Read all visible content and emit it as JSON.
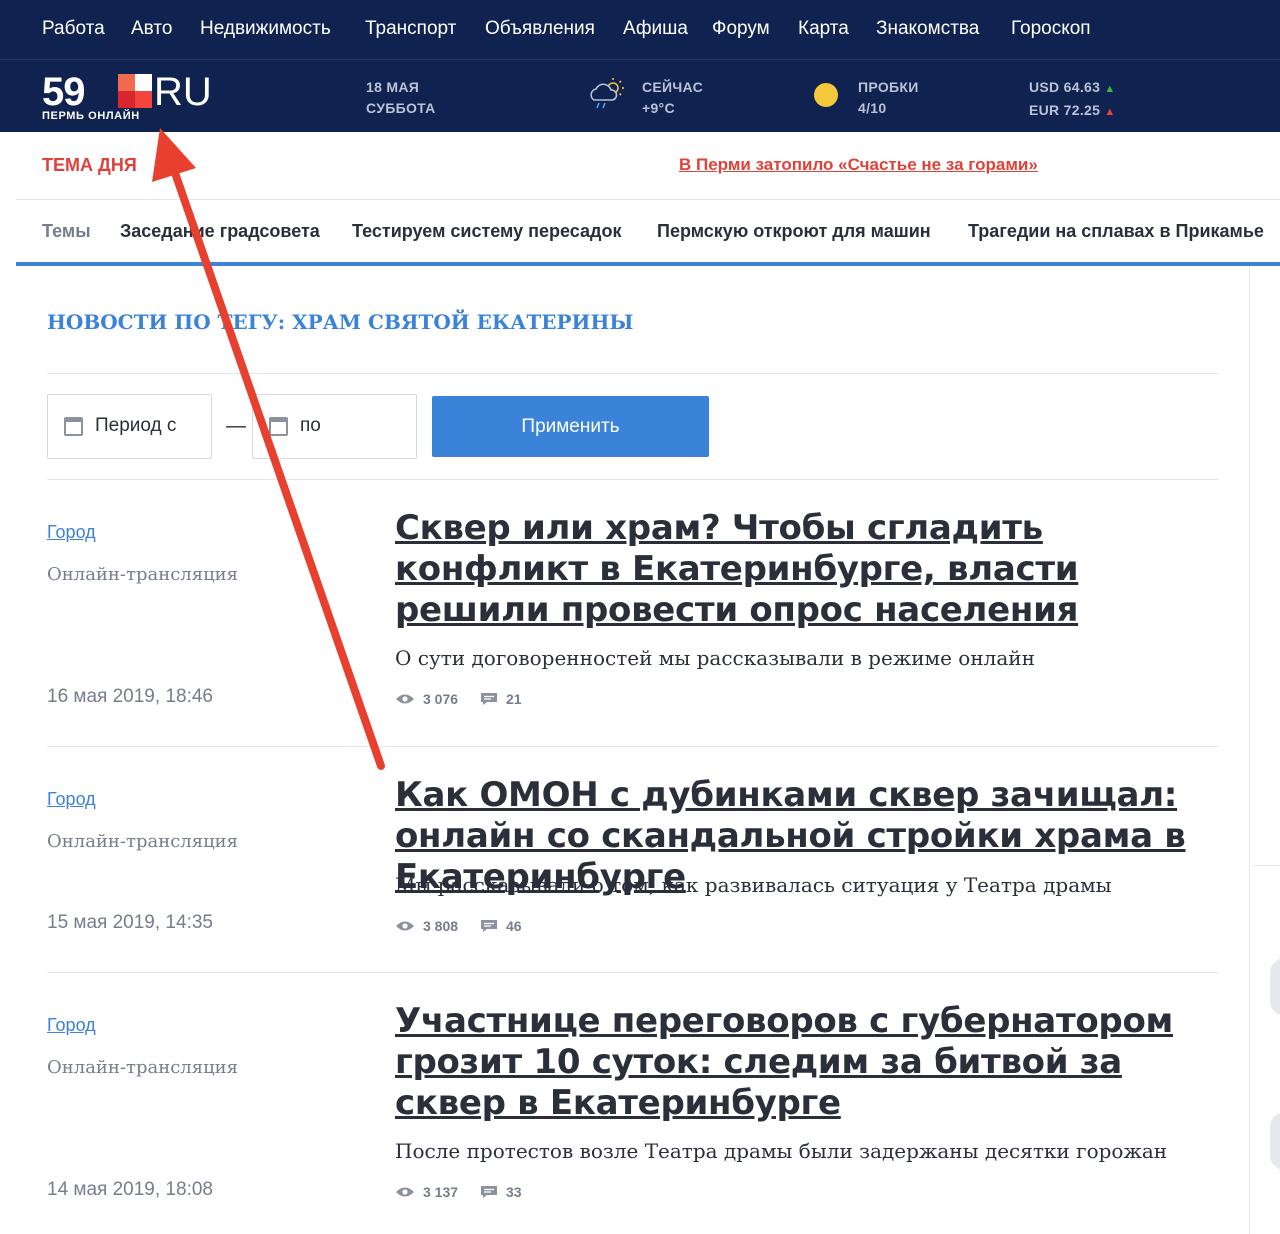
{
  "topnav": [
    "Работа",
    "Авто",
    "Недвижимость",
    "Транспорт",
    "Объявления",
    "Афиша",
    "Форум",
    "Карта",
    "Знакомства",
    "Гороскоп"
  ],
  "header": {
    "logo_number": "59",
    "logo_domain": "RU",
    "logo_tagline": "ПЕРМЬ ОНЛАЙН",
    "date_line1": "18 МАЯ",
    "date_line2": "СУББОТА",
    "weather_label": "СЕЙЧАС",
    "weather_value": "+9°C",
    "traffic_label": "ПРОБКИ",
    "traffic_value": "4/10",
    "usd": "USD 64.63",
    "eur": "EUR 72.25"
  },
  "tema": {
    "label": "ТЕМА ДНЯ",
    "link": "В Перми затопило «Счастье не за горами»"
  },
  "topics": {
    "label": "Темы",
    "items": [
      "Заседание градсовета",
      "Тестируем систему пересадок",
      "Пермскую откроют для машин",
      "Трагедии на сплавах в Прикамье"
    ]
  },
  "tag_title": "НОВОСТИ ПО ТЕГУ: ХРАМ СВЯТОЙ ЕКАТЕРИНЫ",
  "filter": {
    "from_placeholder": "Период с",
    "separator": "—",
    "to_placeholder": "по",
    "apply_label": "Применить"
  },
  "articles": [
    {
      "rubric": "Город",
      "format": "Онлайн-трансляция",
      "date": "16 мая 2019, 18:46",
      "title": "Сквер или храм? Чтобы сгладить конфликт в Екатеринбурге, власти решили провести опрос населения",
      "lead": "О сути договоренностей мы рассказывали в режиме онлайн",
      "views": "3 076",
      "comments": "21"
    },
    {
      "rubric": "Город",
      "format": "Онлайн-трансляция",
      "date": "15 мая 2019, 14:35",
      "title": "Как ОМОН с дубинками сквер зачищал: онлайн со скандальной стройки храма в Екатеринбурге",
      "lead": "Мы рассказывали о том, как развивалась ситуация у Театра драмы",
      "views": "3 808",
      "comments": "46"
    },
    {
      "rubric": "Город",
      "format": "Онлайн-трансляция",
      "date": "14 мая 2019, 18:08",
      "title": "Участнице переговоров с губернатором грозит 10 суток: следим за битвой за сквер в Екатеринбурге",
      "lead": "После протестов возле Театра драмы были задержаны десятки горожан",
      "views": "3 137",
      "comments": "33"
    }
  ],
  "colors": {
    "header_bg": "#0f2250",
    "accent_blue": "#3b82d9",
    "accent_red": "#e0423a",
    "annotation_arrow": "#e8402f"
  },
  "icons": [
    "calendar-icon",
    "weather-icon",
    "sun-icon",
    "eye-icon",
    "comment-icon",
    "arrow-up-icon",
    "arrow-down-icon"
  ]
}
